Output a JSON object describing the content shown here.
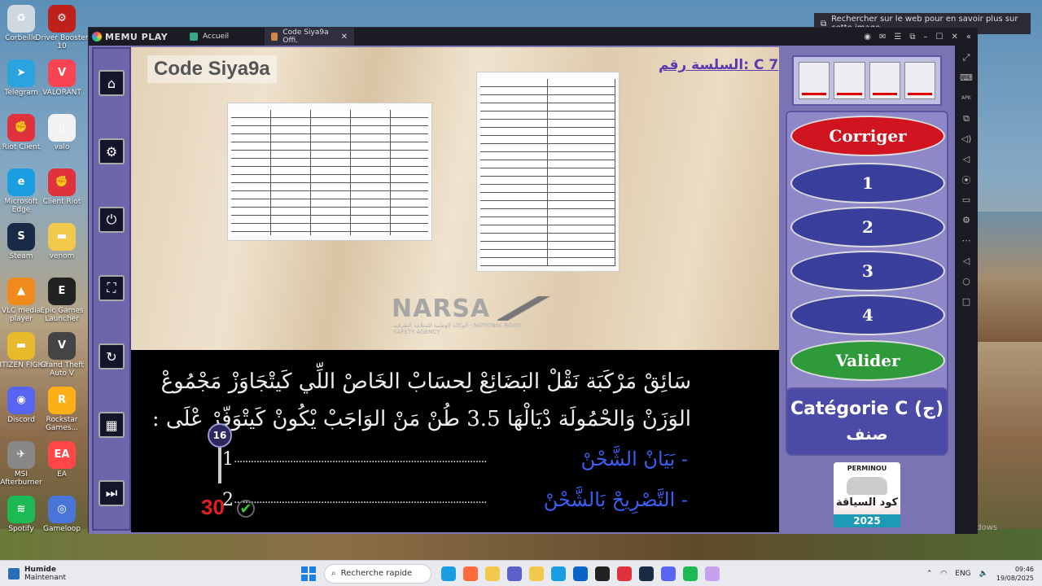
{
  "desktop": {
    "icons_col1": [
      {
        "label": "Corbeille",
        "color": "#cfd8e0",
        "glyph": "♻"
      },
      {
        "label": "Telegram",
        "color": "#2aa3df",
        "glyph": "➤"
      },
      {
        "label": "Riot Client",
        "color": "#e0323c",
        "glyph": "✊"
      },
      {
        "label": "Microsoft Edge",
        "color": "#1b9de2",
        "glyph": "e"
      },
      {
        "label": "Steam",
        "color": "#1a2b47",
        "glyph": "S"
      },
      {
        "label": "VLC media player",
        "color": "#f08a1c",
        "glyph": "▲"
      },
      {
        "label": "CITIZEN FIGHT",
        "color": "#e8b92a",
        "glyph": "▬"
      },
      {
        "label": "Discord",
        "color": "#5865f2",
        "glyph": "◉"
      },
      {
        "label": "MSI Afterburner",
        "color": "#888",
        "glyph": "✈"
      },
      {
        "label": "Spotify",
        "color": "#1db954",
        "glyph": "≋"
      }
    ],
    "icons_col2": [
      {
        "label": "Driver Booster 10",
        "color": "#c0201a",
        "glyph": "⚙"
      },
      {
        "label": "VALORANT",
        "color": "#fa4454",
        "glyph": "V"
      },
      {
        "label": "valo",
        "color": "#f2f2f2",
        "glyph": "▯"
      },
      {
        "label": "Client Riot",
        "color": "#e0323c",
        "glyph": "✊"
      },
      {
        "label": "venom",
        "color": "#f2c94c",
        "glyph": "▬"
      },
      {
        "label": "Epic Games Launcher",
        "color": "#222",
        "glyph": "E"
      },
      {
        "label": "Grand Theft Auto V",
        "color": "#444",
        "glyph": "V"
      },
      {
        "label": "Rockstar Games...",
        "color": "#fcaf17",
        "glyph": "R"
      },
      {
        "label": "EA",
        "color": "#ff4747",
        "glyph": "EA"
      },
      {
        "label": "Gameloop",
        "color": "#4a74d8",
        "glyph": "◎"
      }
    ],
    "search_tip": "Rechercher sur le web pour en savoir plus sur cette image",
    "watermark": "er Windows"
  },
  "emulator": {
    "brand": "MEMU PLAY",
    "tabs": [
      {
        "label": "Accueil"
      },
      {
        "label": "Code Siya9a Offi."
      }
    ],
    "title_icons": [
      "◉",
      "✉",
      "☰",
      "⧉",
      "–",
      "☐",
      "✕",
      "«"
    ],
    "right_icons": [
      "⤢",
      "⌨",
      "APK",
      "⧉",
      "◁)",
      "◁",
      "⦿",
      "▭",
      "⚙",
      "⋯",
      "◁",
      "○",
      "□"
    ]
  },
  "app": {
    "brand": "Code Siya9a",
    "series": "السلسة رقم: C 7",
    "narsa": "NARSA",
    "narsa_sub": "الوكالة الوطنية للسلامة الطرقية · NATIONAL ROAD SAFETY AGENCY",
    "question_lines": [
      "سَائِقْ مَرْكَبَة نَقْلْ البَضَائِعْ لِحسَابْ الخَاصْ اللِّي كَيتْجَاوَزْ مَجْمُوعْ",
      "الوَزَنْ وَالحْمُولَة دْيَالْهَا 3.5 طُنْ مَنْ الوَاجَبْ يْكُونْ كَيتْوَفّرْ عْلَى :"
    ],
    "answers": [
      {
        "num": "1",
        "text": "- بَيَانْ الشَّحْنْ"
      },
      {
        "num": "2",
        "text": "- التَّصْرِيحْ بَالشَّحْنْ"
      }
    ],
    "dots": "..........................................................................................",
    "question_number": "16",
    "timer": "30",
    "buttons": {
      "corriger": "Corriger",
      "options": [
        "1",
        "2",
        "3",
        "4"
      ],
      "valider": "Valider"
    },
    "category": {
      "fr": "Catégorie C (ج)",
      "ar": "صنف"
    },
    "badge": {
      "top": "PERMINOU",
      "ar": "كود السياقة",
      "year": "2025"
    }
  },
  "taskbar": {
    "weather_title": "Humide",
    "weather_sub": "Maintenant",
    "search": "Recherche rapide",
    "lang": "ENG",
    "time": "09:46",
    "date": "19/08/2025",
    "apps": [
      "#1b9de2",
      "#ff6a3d",
      "#f2c94c",
      "#5b5fc7",
      "#f2c94c",
      "#1b9de2",
      "#0a64c8",
      "#222",
      "#e0323c",
      "#1a2b47",
      "#5865f2",
      "#1db954",
      "#c7a0f0"
    ]
  }
}
